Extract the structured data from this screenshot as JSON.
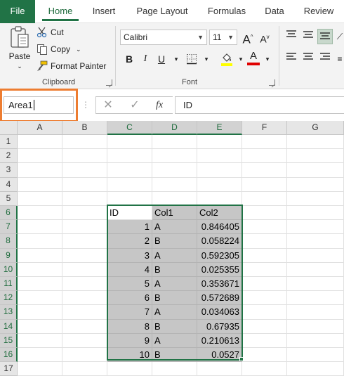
{
  "tabs": [
    "File",
    "Home",
    "Insert",
    "Page Layout",
    "Formulas",
    "Data",
    "Review"
  ],
  "clipboard": {
    "paste_label": "Paste",
    "cut_label": "Cut",
    "copy_label": "Copy",
    "format_painter_label": "Format Painter",
    "group_label": "Clipboard"
  },
  "font": {
    "family": "Calibri",
    "size": "11",
    "grow_label": "A",
    "shrink_label": "A",
    "bold": "B",
    "italic": "I",
    "underline": "U",
    "font_color_label": "A",
    "group_label": "Font",
    "highlight_color": "#ffff00",
    "font_color": "#e00000"
  },
  "formula_bar": {
    "name_box": "Area1",
    "fx_label": "fx",
    "formula": "ID"
  },
  "columns": [
    "A",
    "B",
    "C",
    "D",
    "E",
    "F",
    "G"
  ],
  "rows": [
    "1",
    "2",
    "3",
    "4",
    "5",
    "6",
    "7",
    "8",
    "9",
    "10",
    "11",
    "12",
    "13",
    "14",
    "15",
    "16",
    "17"
  ],
  "table": {
    "headers": [
      "ID",
      "Col1",
      "Col2"
    ],
    "rows": [
      [
        "1",
        "A",
        "0.846405"
      ],
      [
        "2",
        "B",
        "0.058224"
      ],
      [
        "3",
        "A",
        "0.592305"
      ],
      [
        "4",
        "B",
        "0.025355"
      ],
      [
        "5",
        "A",
        "0.353671"
      ],
      [
        "6",
        "B",
        "0.572689"
      ],
      [
        "7",
        "A",
        "0.034063"
      ],
      [
        "8",
        "B",
        "0.67935"
      ],
      [
        "9",
        "A",
        "0.210613"
      ],
      [
        "10",
        "B",
        "0.0527"
      ]
    ]
  },
  "colors": {
    "excel_green": "#217346",
    "highlight_orange": "#ed7d31",
    "selection_shade": "#c6c6c6"
  }
}
